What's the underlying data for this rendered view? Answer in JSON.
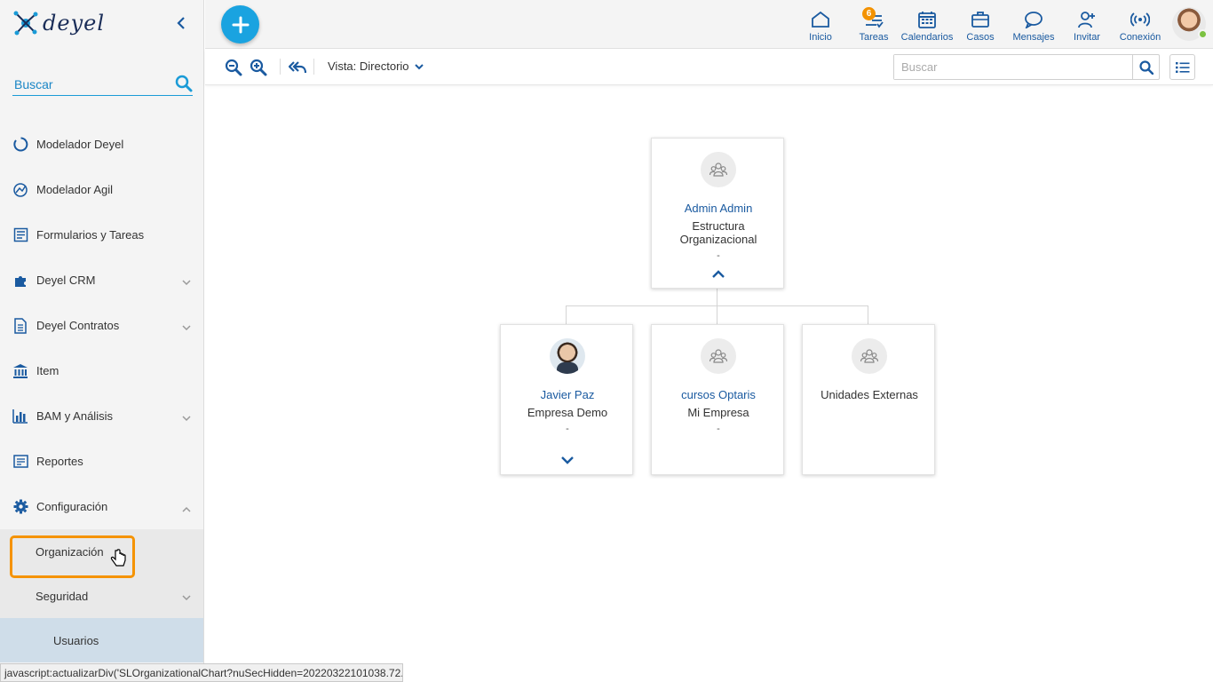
{
  "app": {
    "brand": "deyel"
  },
  "sidebar": {
    "search_placeholder": "Buscar",
    "items": [
      {
        "label": "Modelador Deyel",
        "icon": "circle-loader-icon",
        "expandable": false
      },
      {
        "label": "Modelador Agil",
        "icon": "agile-compass-icon",
        "expandable": false
      },
      {
        "label": "Formularios y Tareas",
        "icon": "form-icon",
        "expandable": false
      },
      {
        "label": "Deyel CRM",
        "icon": "puzzle-icon",
        "expandable": true
      },
      {
        "label": "Deyel Contratos",
        "icon": "document-icon",
        "expandable": true
      },
      {
        "label": "Item",
        "icon": "bank-icon",
        "expandable": false
      },
      {
        "label": "BAM y Análisis",
        "icon": "bar-chart-icon",
        "expandable": true
      },
      {
        "label": "Reportes",
        "icon": "report-icon",
        "expandable": false
      },
      {
        "label": "Configuración",
        "icon": "gear-icon",
        "expandable": true,
        "expanded": true
      }
    ],
    "sub_items": [
      {
        "label": "Organización",
        "highlighted": true
      },
      {
        "label": "Seguridad",
        "expandable": true
      }
    ],
    "sub_sub_items": [
      {
        "label": "Usuarios"
      }
    ]
  },
  "topbar": {
    "nav": [
      {
        "label": "Inicio",
        "icon": "home-icon"
      },
      {
        "label": "Tareas",
        "icon": "tasks-icon",
        "badge": "6"
      },
      {
        "label": "Calendarios",
        "icon": "calendar-icon"
      },
      {
        "label": "Casos",
        "icon": "briefcase-icon"
      },
      {
        "label": "Mensajes",
        "icon": "chat-bubble-icon"
      },
      {
        "label": "Invitar",
        "icon": "add-user-icon"
      },
      {
        "label": "Conexión",
        "icon": "broadcast-icon"
      }
    ]
  },
  "toolbar": {
    "view_label": "Vista: Directorio",
    "search_placeholder": "Buscar"
  },
  "orgchart": {
    "root": {
      "name": "Admin Admin",
      "subtitle": "Estructura Organizacional",
      "detail": "-",
      "icon": "group-icon"
    },
    "children": [
      {
        "name": "Javier Paz",
        "subtitle": "Empresa Demo",
        "detail": "-",
        "icon": "person-photo"
      },
      {
        "name": "cursos Optaris",
        "subtitle": "Mi Empresa",
        "detail": "-",
        "icon": "group-icon"
      },
      {
        "name": "Unidades Externas",
        "subtitle": "",
        "detail": "",
        "icon": "group-icon"
      }
    ]
  },
  "statusbar": {
    "text": "javascript:actualizarDiv('SLOrganizationalChart?nuSecHidden=20220322101038.72..."
  },
  "colors": {
    "accent": "#1aa3e0",
    "link": "#1a5aa0",
    "badge": "#f39200",
    "highlight": "#f59300"
  }
}
